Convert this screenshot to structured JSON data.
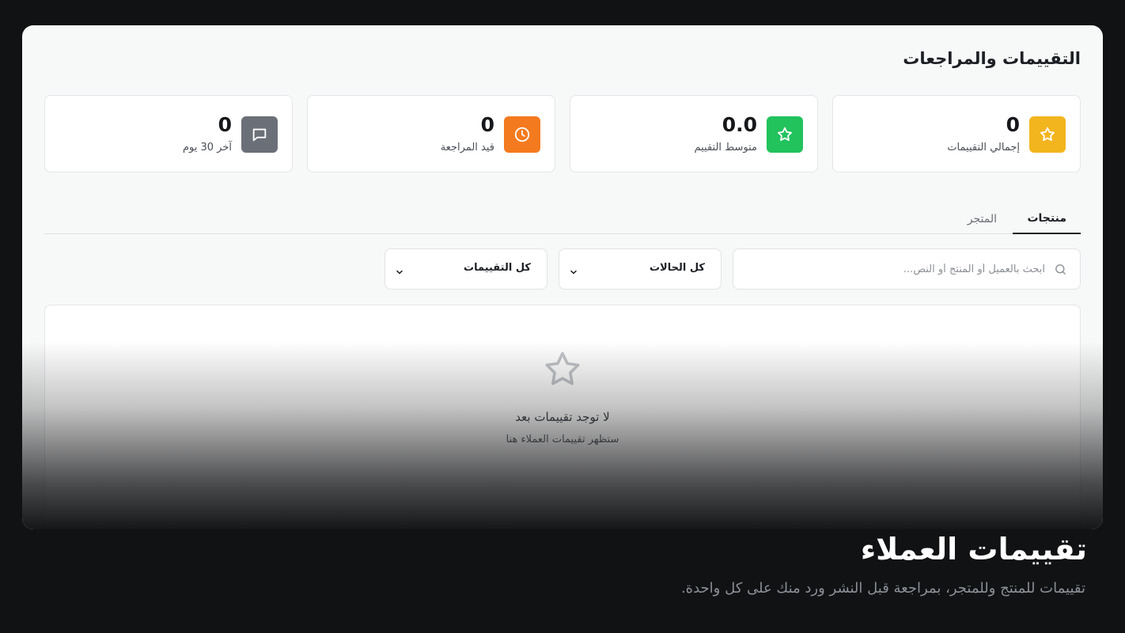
{
  "page": {
    "title": "التقييمات والمراجعات"
  },
  "stats": [
    {
      "value": "0",
      "label": "إجمالي التقييمات",
      "icon": "star-icon",
      "color": "#f2b51e"
    },
    {
      "value": "0.0",
      "label": "متوسط التقييم",
      "icon": "star-icon",
      "color": "#22c25d"
    },
    {
      "value": "0",
      "label": "قيد المراجعة",
      "icon": "clock-icon",
      "color": "#f47a1f"
    },
    {
      "value": "0",
      "label": "آخر 30 يوم",
      "icon": "message-icon",
      "color": "#6b7078"
    }
  ],
  "tabs": [
    {
      "label": "منتجات",
      "active": true
    },
    {
      "label": "المتجر",
      "active": false
    }
  ],
  "filters": {
    "search_placeholder": "ابحث بالعميل أو المنتج أو النص...",
    "status_select": "كل الحالات",
    "rating_select": "كل التقييمات"
  },
  "empty_state": {
    "icon": "star-outline-icon",
    "title": "لا توجد تقييمات بعد",
    "subtitle": "ستظهر تقييمات العملاء هنا"
  },
  "hero": {
    "title": "تقييمات العملاء",
    "subtitle": "تقييمات للمنتج وللمتجر، بمراجعة قبل النشر ورد منك على كل واحدة."
  }
}
